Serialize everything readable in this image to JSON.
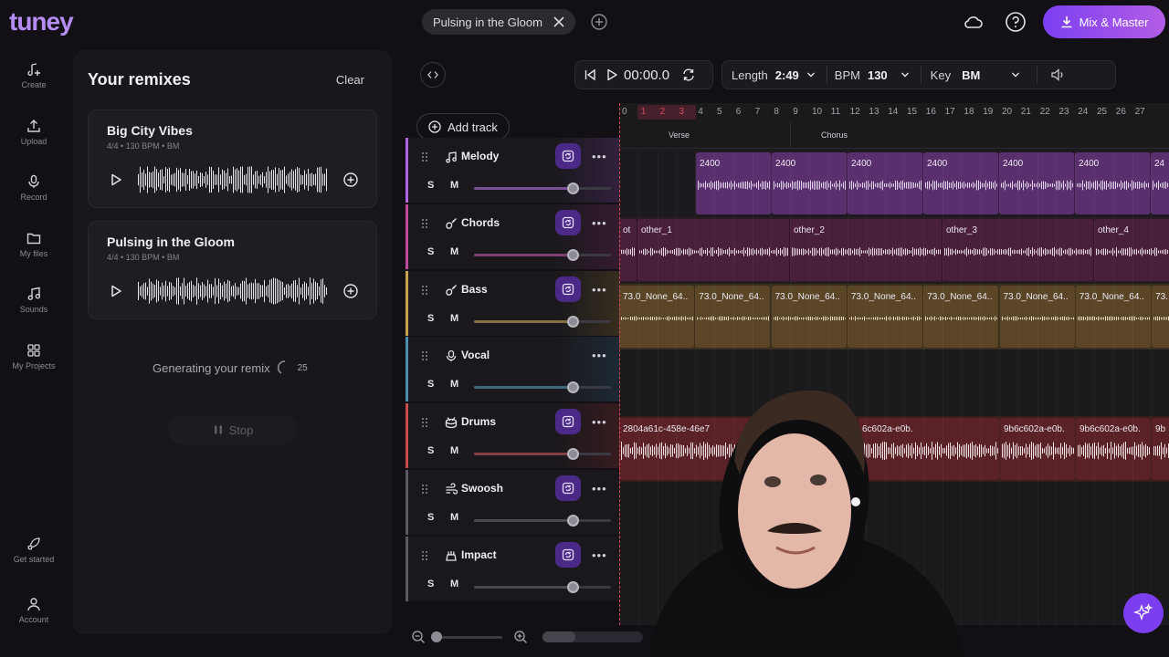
{
  "app": {
    "logo": "tuney"
  },
  "header": {
    "open_tab": "Pulsing in the Gloom",
    "mix_button": "Mix & Master"
  },
  "nav": [
    {
      "label": "Create",
      "icon": "create-icon"
    },
    {
      "label": "Upload",
      "icon": "upload-icon"
    },
    {
      "label": "Record",
      "icon": "mic-icon"
    },
    {
      "label": "My files",
      "icon": "folder-icon"
    },
    {
      "label": "Sounds",
      "icon": "music-note-icon"
    },
    {
      "label": "My Projects",
      "icon": "grid-icon"
    },
    {
      "label": "Get started",
      "icon": "rocket-icon"
    },
    {
      "label": "Account",
      "icon": "user-icon"
    }
  ],
  "remixes": {
    "title": "Your remixes",
    "clear_label": "Clear",
    "items": [
      {
        "name": "Big City Vibes",
        "meta": "4/4 • 130 BPM • BM"
      },
      {
        "name": "Pulsing in the Gloom",
        "meta": "4/4 • 130 BPM • BM"
      }
    ],
    "generating_text": "Generating your remix",
    "generating_progress": "25",
    "stop_label": "Stop"
  },
  "transport": {
    "time": "00:00.0",
    "length_label": "Length",
    "length_value": "2:49",
    "bpm_label": "BPM",
    "bpm_value": "130",
    "key_label": "Key",
    "key_value": "BM"
  },
  "add_track_label": "Add track",
  "tracks": [
    {
      "name": "Melody",
      "icon": "music-note-icon",
      "volume": 0.72,
      "color": "#b064e0"
    },
    {
      "name": "Chords",
      "icon": "guitar-icon",
      "volume": 0.72,
      "color": "#c04a9a"
    },
    {
      "name": "Bass",
      "icon": "guitar-icon",
      "volume": 0.72,
      "color": "#c9a04a"
    },
    {
      "name": "Vocal",
      "icon": "mic-icon",
      "volume": 0.72,
      "color": "#4a8fb0"
    },
    {
      "name": "Drums",
      "icon": "drum-icon",
      "volume": 0.72,
      "color": "#c94a4a"
    },
    {
      "name": "Swoosh",
      "icon": "wind-icon",
      "volume": 0.72,
      "color": "#5a5860"
    },
    {
      "name": "Impact",
      "icon": "impact-icon",
      "volume": 0.72,
      "color": "#5a5860"
    }
  ],
  "timeline": {
    "bars": [
      "0",
      "1",
      "2",
      "3",
      "4",
      "5",
      "6",
      "7",
      "8",
      "9",
      "10",
      "11",
      "12",
      "13",
      "14",
      "15",
      "16",
      "17",
      "18",
      "19",
      "20",
      "21",
      "22",
      "23",
      "24",
      "25",
      "26",
      "27"
    ],
    "sections": [
      "Verse",
      "Chorus"
    ],
    "melody_clips": [
      "2400",
      "2400",
      "2400",
      "2400",
      "2400",
      "2400",
      "24"
    ],
    "chord_clips": [
      "ot",
      "other_1",
      "other_2",
      "other_3",
      "other_4"
    ],
    "bass_clips": [
      "73.0_None_64..",
      "73.0_None_64..",
      "73.0_None_64..",
      "73.0_None_64..",
      "73.0_None_64..",
      "73.0_None_64..",
      "73.0_None_64..",
      "73."
    ],
    "drum_clips": [
      "2804a61c-458e-46e7",
      "6c602a-e0b.",
      "9b6c602a-e0b.",
      "9b6c602a-e0b.",
      "9b"
    ]
  },
  "colors": {
    "accent": "#7b3ff0",
    "melody_clip": "#5a2f6e",
    "chord_clip": "#4a1f3a",
    "bass_clip": "#5a4526",
    "drum_clip": "#5a2226"
  }
}
